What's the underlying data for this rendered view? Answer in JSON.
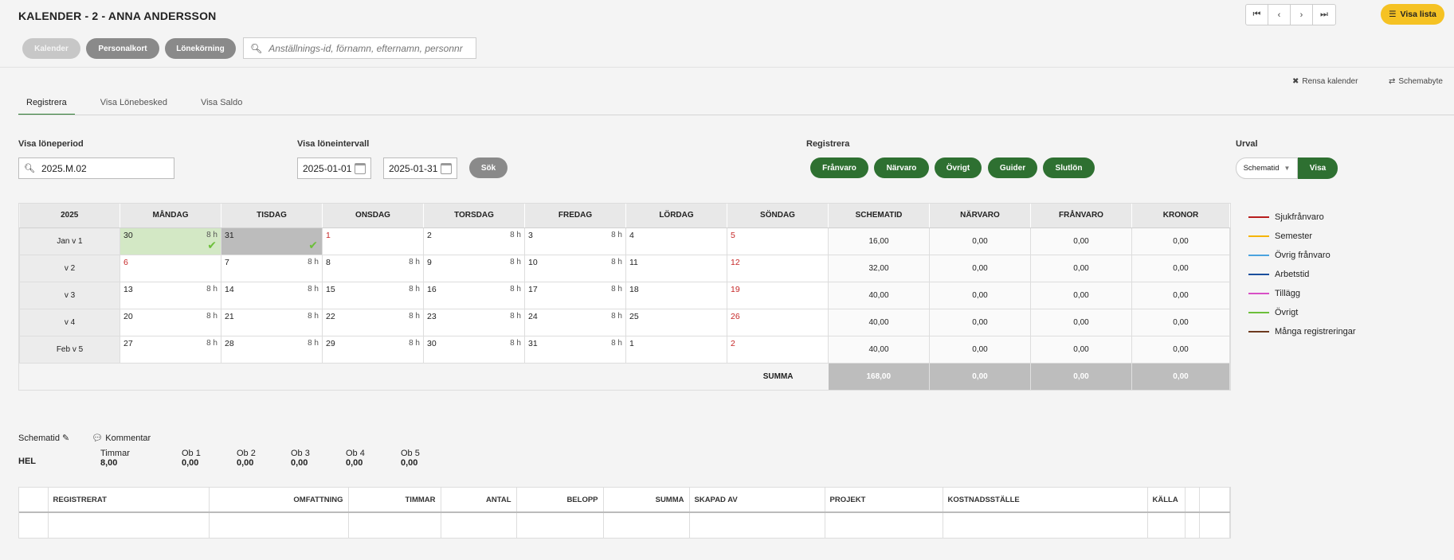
{
  "header": {
    "title": "KALENDER - 2 - ANNA ANDERSSON",
    "visa_lista": "Visa lista",
    "buttons": {
      "kalender": "Kalender",
      "personalkort": "Personalkort",
      "lonekorning": "Lönekörning"
    },
    "search_placeholder": "Anställnings-id, förnamn, efternamn, personnr"
  },
  "actions": {
    "rensa": "Rensa kalender",
    "schemabyte": "Schemabyte"
  },
  "tabs": [
    "Registrera",
    "Visa Lönebesked",
    "Visa Saldo"
  ],
  "filters": {
    "loneperiod_label": "Visa löneperiod",
    "loneperiod_value": "2025.M.02",
    "intervall_label": "Visa löneintervall",
    "from": "2025-01-01",
    "to": "2025-01-31",
    "sok": "Sök",
    "registrera_label": "Registrera",
    "reg_buttons": [
      "Frånvaro",
      "Närvaro",
      "Övrigt",
      "Guider",
      "Slutlön"
    ],
    "urval_label": "Urval",
    "urval_select": "Schematid",
    "urval_visa": "Visa"
  },
  "calendar": {
    "headers": [
      "2025",
      "MÅNDAG",
      "TISDAG",
      "ONSDAG",
      "TORSDAG",
      "FREDAG",
      "LÖRDAG",
      "SÖNDAG",
      "SCHEMATID",
      "NÄRVARO",
      "FRÅNVARO",
      "KRONOR"
    ],
    "rows": [
      {
        "week": "Jan v 1",
        "days": [
          {
            "d": "30",
            "h": "8 h",
            "state": "green",
            "check": true
          },
          {
            "d": "31",
            "h": "",
            "state": "grey",
            "check": true
          },
          {
            "d": "1",
            "h": "",
            "red": true
          },
          {
            "d": "2",
            "h": "8 h"
          },
          {
            "d": "3",
            "h": "8 h"
          },
          {
            "d": "4",
            "h": ""
          },
          {
            "d": "5",
            "h": "",
            "red": true
          }
        ],
        "sums": [
          "16,00",
          "0,00",
          "0,00",
          "0,00"
        ]
      },
      {
        "week": "v 2",
        "days": [
          {
            "d": "6",
            "h": "",
            "red": true
          },
          {
            "d": "7",
            "h": "8 h"
          },
          {
            "d": "8",
            "h": "8 h"
          },
          {
            "d": "9",
            "h": "8 h"
          },
          {
            "d": "10",
            "h": "8 h"
          },
          {
            "d": "11",
            "h": ""
          },
          {
            "d": "12",
            "h": "",
            "red": true
          }
        ],
        "sums": [
          "32,00",
          "0,00",
          "0,00",
          "0,00"
        ]
      },
      {
        "week": "v 3",
        "days": [
          {
            "d": "13",
            "h": "8 h"
          },
          {
            "d": "14",
            "h": "8 h"
          },
          {
            "d": "15",
            "h": "8 h"
          },
          {
            "d": "16",
            "h": "8 h"
          },
          {
            "d": "17",
            "h": "8 h"
          },
          {
            "d": "18",
            "h": ""
          },
          {
            "d": "19",
            "h": "",
            "red": true
          }
        ],
        "sums": [
          "40,00",
          "0,00",
          "0,00",
          "0,00"
        ]
      },
      {
        "week": "v 4",
        "days": [
          {
            "d": "20",
            "h": "8 h"
          },
          {
            "d": "21",
            "h": "8 h"
          },
          {
            "d": "22",
            "h": "8 h"
          },
          {
            "d": "23",
            "h": "8 h"
          },
          {
            "d": "24",
            "h": "8 h"
          },
          {
            "d": "25",
            "h": ""
          },
          {
            "d": "26",
            "h": "",
            "red": true
          }
        ],
        "sums": [
          "40,00",
          "0,00",
          "0,00",
          "0,00"
        ]
      },
      {
        "week": "Feb v 5",
        "days": [
          {
            "d": "27",
            "h": "8 h"
          },
          {
            "d": "28",
            "h": "8 h"
          },
          {
            "d": "29",
            "h": "8 h"
          },
          {
            "d": "30",
            "h": "8 h"
          },
          {
            "d": "31",
            "h": "8 h"
          },
          {
            "d": "1",
            "h": ""
          },
          {
            "d": "2",
            "h": "",
            "red": true
          }
        ],
        "sums": [
          "40,00",
          "0,00",
          "0,00",
          "0,00"
        ]
      }
    ],
    "summa_label": "SUMMA",
    "summa": [
      "168,00",
      "0,00",
      "0,00",
      "0,00"
    ]
  },
  "legend": [
    {
      "label": "Sjukfrånvaro",
      "color": "#b71c1c"
    },
    {
      "label": "Semester",
      "color": "#f5b400"
    },
    {
      "label": "Övrig frånvaro",
      "color": "#4aa3df"
    },
    {
      "label": "Arbetstid",
      "color": "#1a4f9c"
    },
    {
      "label": "Tillägg",
      "color": "#d84fc6"
    },
    {
      "label": "Övrigt",
      "color": "#6cbf3a"
    },
    {
      "label": "Många registreringar",
      "color": "#6d3a1e"
    }
  ],
  "schema": {
    "schematid": "Schematid",
    "kommentar": "Kommentar",
    "type": "HEL",
    "cols": [
      {
        "label": "Timmar",
        "value": "8,00"
      },
      {
        "label": "Ob 1",
        "value": "0,00"
      },
      {
        "label": "Ob 2",
        "value": "0,00"
      },
      {
        "label": "Ob 3",
        "value": "0,00"
      },
      {
        "label": "Ob 4",
        "value": "0,00"
      },
      {
        "label": "Ob 5",
        "value": "0,00"
      }
    ]
  },
  "reg_table": {
    "headers": [
      "",
      "REGISTRERAT",
      "OMFATTNING",
      "TIMMAR",
      "ANTAL",
      "BELOPP",
      "SUMMA",
      "SKAPAD AV",
      "PROJEKT",
      "KOSTNADSSTÄLLE",
      "KÄLLA",
      "",
      ""
    ]
  }
}
